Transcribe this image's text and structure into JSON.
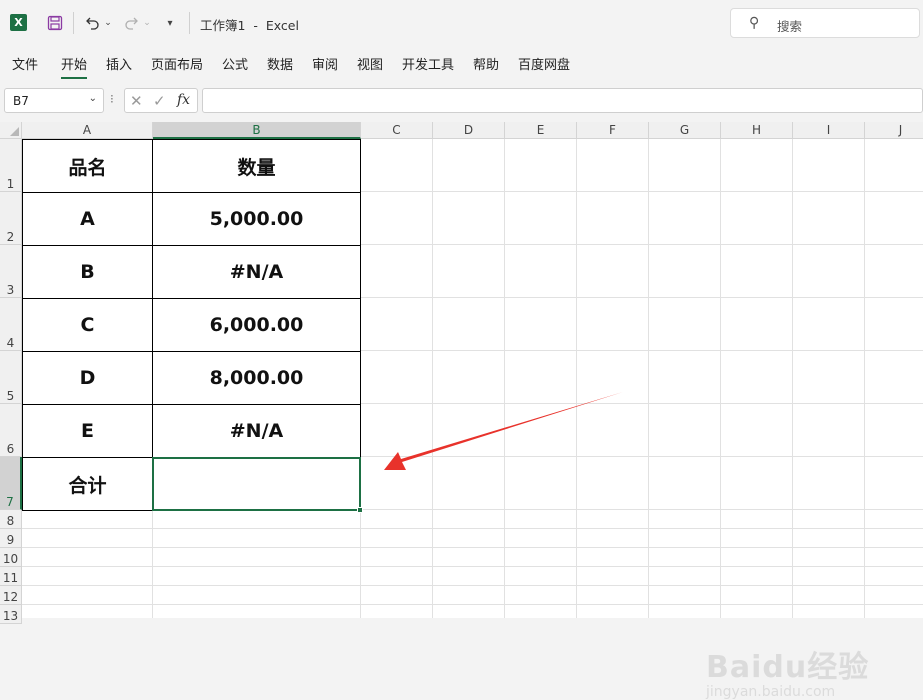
{
  "titlebar": {
    "app_logo": "X",
    "title": "工作簿1  -  Excel",
    "search_placeholder": "搜索"
  },
  "ribbon": {
    "tabs": [
      "文件",
      "开始",
      "插入",
      "页面布局",
      "公式",
      "数据",
      "审阅",
      "视图",
      "开发工具",
      "帮助",
      "百度网盘"
    ],
    "active_tab": "开始"
  },
  "formula_bar": {
    "name_box": "B7",
    "fx_label": "fx",
    "formula": ""
  },
  "columns": [
    "A",
    "B",
    "C",
    "D",
    "E",
    "F",
    "G",
    "H",
    "I",
    "J"
  ],
  "rows": [
    "1",
    "2",
    "3",
    "4",
    "5",
    "6",
    "7",
    "8",
    "9",
    "10",
    "11",
    "12",
    "13"
  ],
  "table": {
    "headers": [
      "品名",
      "数量"
    ],
    "rows": [
      [
        "A",
        "5,000.00"
      ],
      [
        "B",
        "#N/A"
      ],
      [
        "C",
        "6,000.00"
      ],
      [
        "D",
        "8,000.00"
      ],
      [
        "E",
        "#N/A"
      ],
      [
        "合计",
        ""
      ]
    ]
  },
  "selected_cell": "B7",
  "colors": {
    "accent": "#1d7044",
    "arrow": "#e8322b"
  },
  "watermark": {
    "main": "Baidu经验",
    "sub": "jingyan.baidu.com"
  }
}
